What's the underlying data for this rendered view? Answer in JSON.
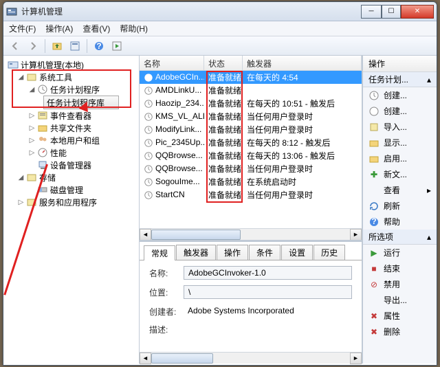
{
  "title": "计算机管理",
  "menu": {
    "file": "文件(F)",
    "action": "操作(A)",
    "view": "查看(V)",
    "help": "帮助(H)"
  },
  "tree": {
    "root": "计算机管理(本地)",
    "systools": "系统工具",
    "tasksched": "任务计划程序",
    "tasklib": "任务计划程序库",
    "eventvwr": "事件查看器",
    "shared": "共享文件夹",
    "localusers": "本地用户和组",
    "perf": "性能",
    "devmgr": "设备管理器",
    "storage": "存储",
    "diskmgmt": "磁盘管理",
    "services": "服务和应用程序"
  },
  "cols": {
    "name": "名称",
    "state": "状态",
    "trigger": "触发器"
  },
  "tasks": [
    {
      "name": "AdobeGCIn...",
      "state": "准备就绪",
      "trigger": "在每天的 4:54"
    },
    {
      "name": "AMDLinkU...",
      "state": "准备就绪",
      "trigger": ""
    },
    {
      "name": "Haozip_234...",
      "state": "准备就绪",
      "trigger": "在每天的 10:51 - 触发后"
    },
    {
      "name": "KMS_VL_ALL",
      "state": "准备就绪",
      "trigger": "当任何用户登录时"
    },
    {
      "name": "ModifyLink...",
      "state": "准备就绪",
      "trigger": "当任何用户登录时"
    },
    {
      "name": "Pic_2345Up...",
      "state": "准备就绪",
      "trigger": "在每天的 8:12 - 触发后"
    },
    {
      "name": "QQBrowse...",
      "state": "准备就绪",
      "trigger": "在每天的 13:06 - 触发后"
    },
    {
      "name": "QQBrowse...",
      "state": "准备就绪",
      "trigger": "当任何用户登录时"
    },
    {
      "name": "SogouIme...",
      "state": "准备就绪",
      "trigger": "在系统启动时"
    },
    {
      "name": "StartCN",
      "state": "准备就绪",
      "trigger": "当任何用户登录时"
    }
  ],
  "detail": {
    "tabs": {
      "general": "常规",
      "triggers": "触发器",
      "actions": "操作",
      "conditions": "条件",
      "settings": "设置",
      "history": "历史"
    },
    "name_label": "名称:",
    "name_val": "AdobeGCInvoker-1.0",
    "loc_label": "位置:",
    "loc_val": "\\",
    "author_label": "创建者:",
    "author_val": "Adobe Systems Incorporated",
    "desc_label": "描述:"
  },
  "actions": {
    "header": "操作",
    "group1": "任务计划...",
    "create": "创建...",
    "createb": "创建...",
    "import": "导入...",
    "display": "显示...",
    "enable": "启用...",
    "newfolder": "新文...",
    "view": "查看",
    "refresh": "刷新",
    "help": "帮助",
    "group2": "所选项",
    "run": "运行",
    "end": "结束",
    "disable": "禁用",
    "export": "导出...",
    "props": "属性",
    "delete": "删除"
  }
}
